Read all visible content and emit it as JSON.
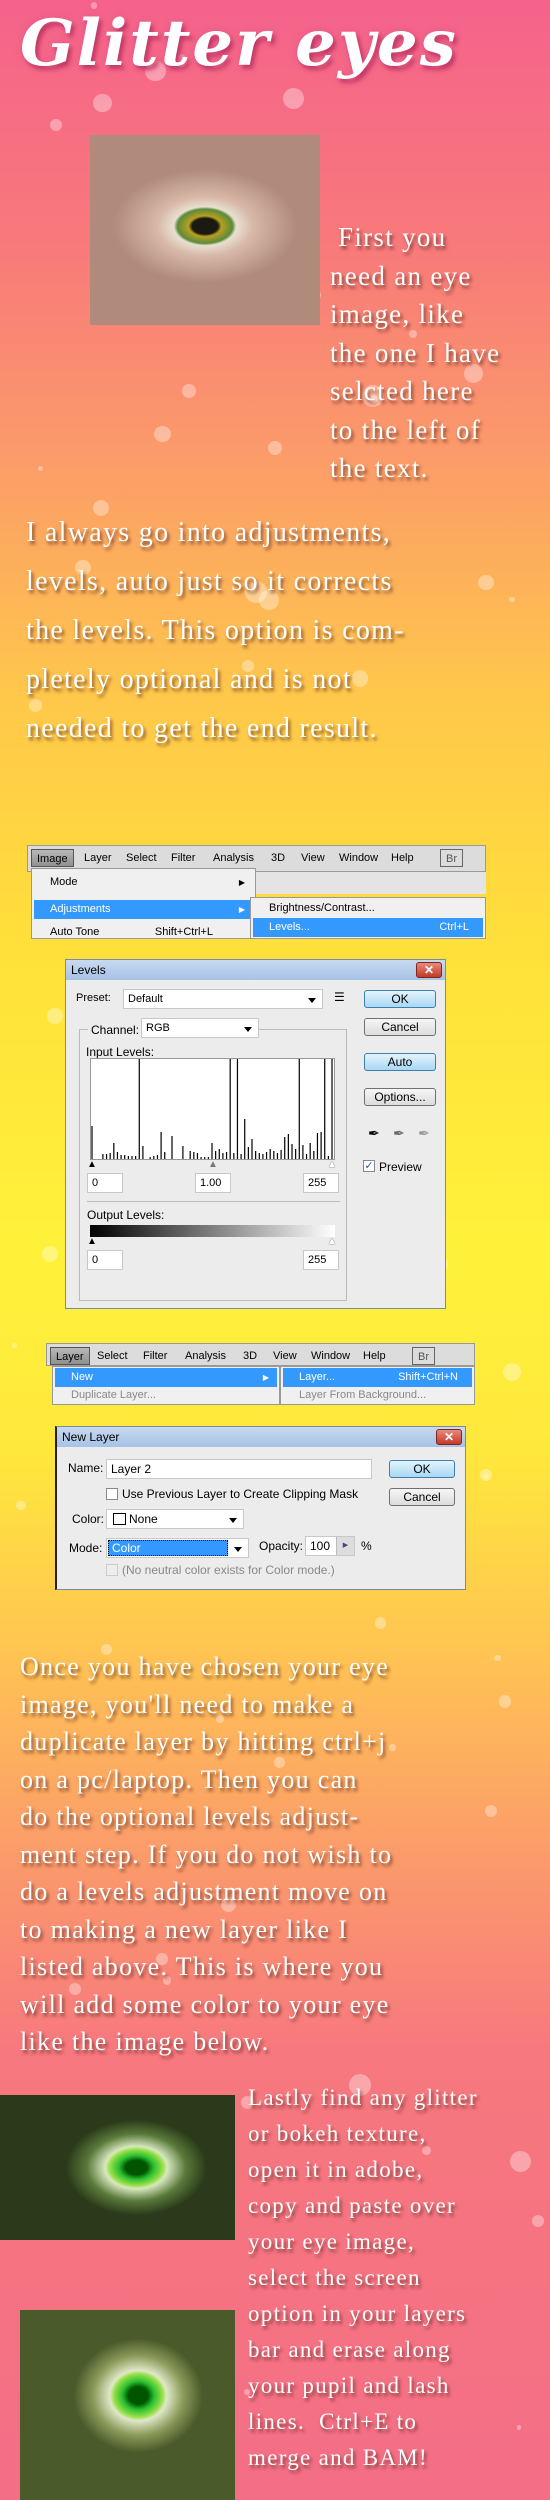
{
  "title": "Glitter eyes",
  "paragraphs": {
    "p1": [
      "First you",
      "need an eye",
      "image, like",
      "the one I have",
      "selcted here",
      "to the left of",
      "the  text."
    ],
    "p2": [
      "I always go into adjustments,",
      "levels, auto just so it corrects",
      "the levels. This option is com-",
      "pletely optional and is not",
      "needed to get the end result."
    ],
    "p3": [
      "Once you have chosen your eye",
      "image, you'll need to make a",
      "duplicate layer by hitting ctrl+j",
      "on a pc/laptop. Then you can",
      "do the optional levels adjust-",
      "ment step. If you do not wish to",
      "do a levels adjustment move on",
      "to making a new layer like I",
      "listed above. This is where you",
      "will add some color to your eye",
      "like the image below."
    ],
    "p4": [
      "Lastly find any glitter",
      "or bokeh texture,",
      "open it in adobe,",
      "copy and paste over",
      "your eye image,",
      "select the screen",
      "option in your layers",
      "bar and erase along",
      "your pupil and lash",
      "lines.  Ctrl+E to",
      "merge and BAM!"
    ]
  },
  "menu1": {
    "bar": [
      "Image",
      "Layer",
      "Select",
      "Filter",
      "Analysis",
      "3D",
      "View",
      "Window",
      "Help",
      "Br"
    ],
    "items": [
      "Mode",
      "Adjustments",
      "Auto Tone"
    ],
    "auto_tone_shortcut": "Shift+Ctrl+L",
    "submenu": [
      "Brightness/Contrast...",
      "Levels..."
    ],
    "levels_shortcut": "Ctrl+L"
  },
  "levels": {
    "title": "Levels",
    "preset_label": "Preset:",
    "preset": "Default",
    "channel_label": "Channel:",
    "channel": "RGB",
    "input_label": "Input Levels:",
    "input_values": [
      "0",
      "1.00",
      "255"
    ],
    "output_label": "Output Levels:",
    "output_values": [
      "0",
      "255"
    ],
    "buttons": [
      "OK",
      "Cancel",
      "Auto",
      "Options..."
    ],
    "preview_label": "Preview",
    "preview_checked": true,
    "histogram": [
      0.33,
      0,
      0,
      0.05,
      0.05,
      0.06,
      0.16,
      0.07,
      0.04,
      0.04,
      0.03,
      0.03,
      0.03,
      1,
      0.13,
      0,
      0.02,
      0.03,
      0.04,
      0.27,
      0.07,
      0,
      0.23,
      0,
      0,
      0.13,
      0,
      0.08,
      0.07,
      0.06,
      0.02,
      0.02,
      0.02,
      0.16,
      0.08,
      0.1,
      0.06,
      0.07,
      1,
      0.06,
      1,
      0.05,
      0.4,
      0.12,
      0.2,
      0.08,
      0.06,
      0.05,
      0.07,
      0.1,
      0.08,
      0.06,
      0.09,
      0.22,
      0.25,
      0.15,
      0.1,
      1,
      0.14,
      0.05,
      0.16,
      0.08,
      0.26,
      0.27,
      1,
      0.03,
      1
    ]
  },
  "menu2": {
    "bar": [
      "Layer",
      "Select",
      "Filter",
      "Analysis",
      "3D",
      "View",
      "Window",
      "Help",
      "Br"
    ],
    "items": [
      "New",
      "Duplicate Layer..."
    ],
    "submenu": [
      "Layer...",
      "Layer From Background..."
    ],
    "layer_shortcut": "Shift+Ctrl+N"
  },
  "new_layer": {
    "title": "New Layer",
    "name_label": "Name:",
    "name": "Layer 2",
    "clip_label": "Use Previous Layer to Create Clipping Mask",
    "color_label": "Color:",
    "color": "None",
    "mode_label": "Mode:",
    "mode": "Color",
    "opacity_label": "Opacity:",
    "opacity": "100",
    "opacity_unit": "%",
    "neutral_label": "(No neutral color exists for Color mode.)",
    "buttons": [
      "OK",
      "Cancel"
    ]
  },
  "colors": {
    "highlight": "#3399ff",
    "text_shadow": "#5a281e"
  }
}
